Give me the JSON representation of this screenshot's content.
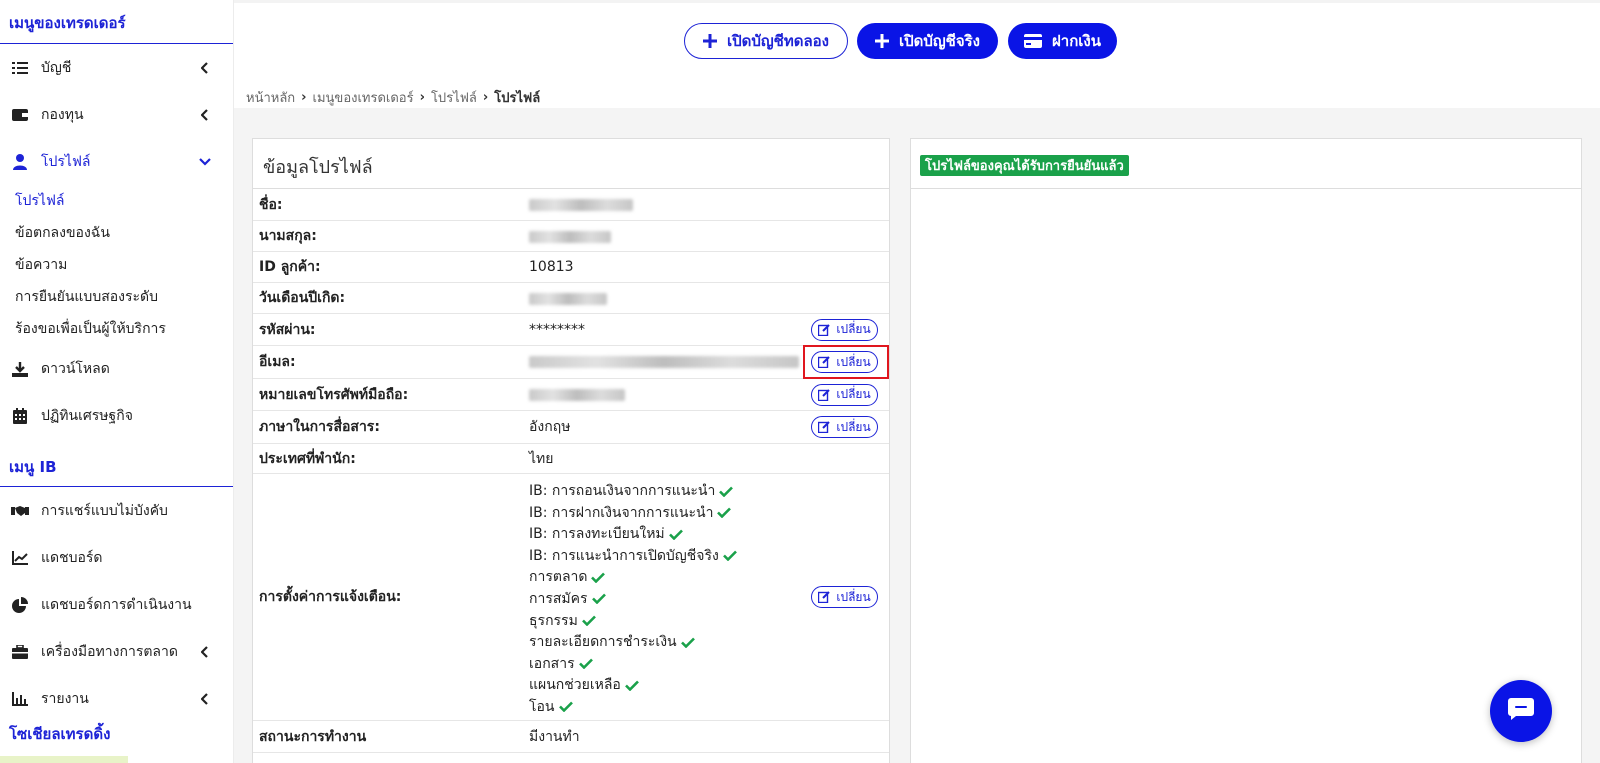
{
  "sidebar": {
    "header": "เมนูของเทรดเดอร์",
    "items": [
      {
        "label": "บัญชี",
        "icon": "list-icon"
      },
      {
        "label": "กองทุน",
        "icon": "wallet-icon"
      },
      {
        "label": "โปรไฟล์",
        "icon": "user-icon"
      }
    ],
    "profile_sub": [
      {
        "label": "โปรไฟล์"
      },
      {
        "label": "ข้อตกลงของฉัน"
      },
      {
        "label": "ข้อความ"
      },
      {
        "label": "การยืนยันแบบสองระดับ"
      },
      {
        "label": "ร้องขอเพื่อเป็นผู้ให้บริการ"
      }
    ],
    "more_items": [
      {
        "label": "ดาวน์โหลด",
        "icon": "download-icon"
      },
      {
        "label": "ปฏิทินเศรษฐกิจ",
        "icon": "calendar-icon"
      }
    ],
    "ib_header": "เมนู IB",
    "ib_items": [
      {
        "label": "การแชร์แบบไม่บังคับ",
        "icon": "handshake-icon"
      },
      {
        "label": "แดชบอร์ด",
        "icon": "line-chart-icon"
      },
      {
        "label": "แดชบอร์ดการดำเนินงาน",
        "icon": "pie-chart-icon"
      },
      {
        "label": "เครื่องมือทางการตลาด",
        "icon": "briefcase-icon"
      },
      {
        "label": "รายงาน",
        "icon": "bar-chart-icon"
      }
    ],
    "social_header": "โซเชียลเทรดดิ้ง"
  },
  "topbar": {
    "demo_button": "เปิดบัญชีทดลอง",
    "real_button": "เปิดบัญชีจริง",
    "deposit_button": "ฝากเงิน"
  },
  "breadcrumb": [
    "หน้าหลัก",
    "เมนูของเทรดเดอร์",
    "โปรไฟล์",
    "โปรไฟล์"
  ],
  "profile": {
    "title": "ข้อมูลโปรไฟล์",
    "change_label": "เปลี่ยน",
    "rows": [
      {
        "label": "ชื่อ:",
        "value": ""
      },
      {
        "label": "นามสกุล:",
        "value": ""
      },
      {
        "label": "ID ลูกค้า:",
        "value": "10813"
      },
      {
        "label": "วันเดือนปีเกิด:",
        "value": ""
      },
      {
        "label": "รหัสผ่าน:",
        "value": "********"
      },
      {
        "label": "อีเมล:",
        "value": ""
      },
      {
        "label": "หมายเลขโทรศัพท์มือถือ:",
        "value": ""
      },
      {
        "label": "ภาษาในการสื่อสาร:",
        "value": "อังกฤษ"
      },
      {
        "label": "ประเทศที่พำนัก:",
        "value": "ไทย"
      },
      {
        "label": "การตั้งค่าการแจ้งเตือน:",
        "value": ""
      },
      {
        "label": "สถานะการทำงาน",
        "value": "มีงานทำ"
      }
    ],
    "notifications": [
      "IB: การถอนเงินจากการแนะนำ",
      "IB: การฝากเงินจากการแนะนำ",
      "IB: การลงทะเบียนใหม่",
      "IB: การแนะนำการเปิดบัญชีจริง",
      "การตลาด",
      "การสมัคร",
      "ธุรกรรม",
      "รายละเอียดการชำระเงิน",
      "เอกสาร",
      "แผนกช่วยเหลือ",
      "โอน"
    ]
  },
  "verified_badge": "โปรไฟล์ของคุณได้รับการยืนยันแล้ว",
  "colors": {
    "accent": "#0a14e6",
    "link": "#1d23d6",
    "success": "#1aa14a",
    "highlight": "#e0161e"
  }
}
